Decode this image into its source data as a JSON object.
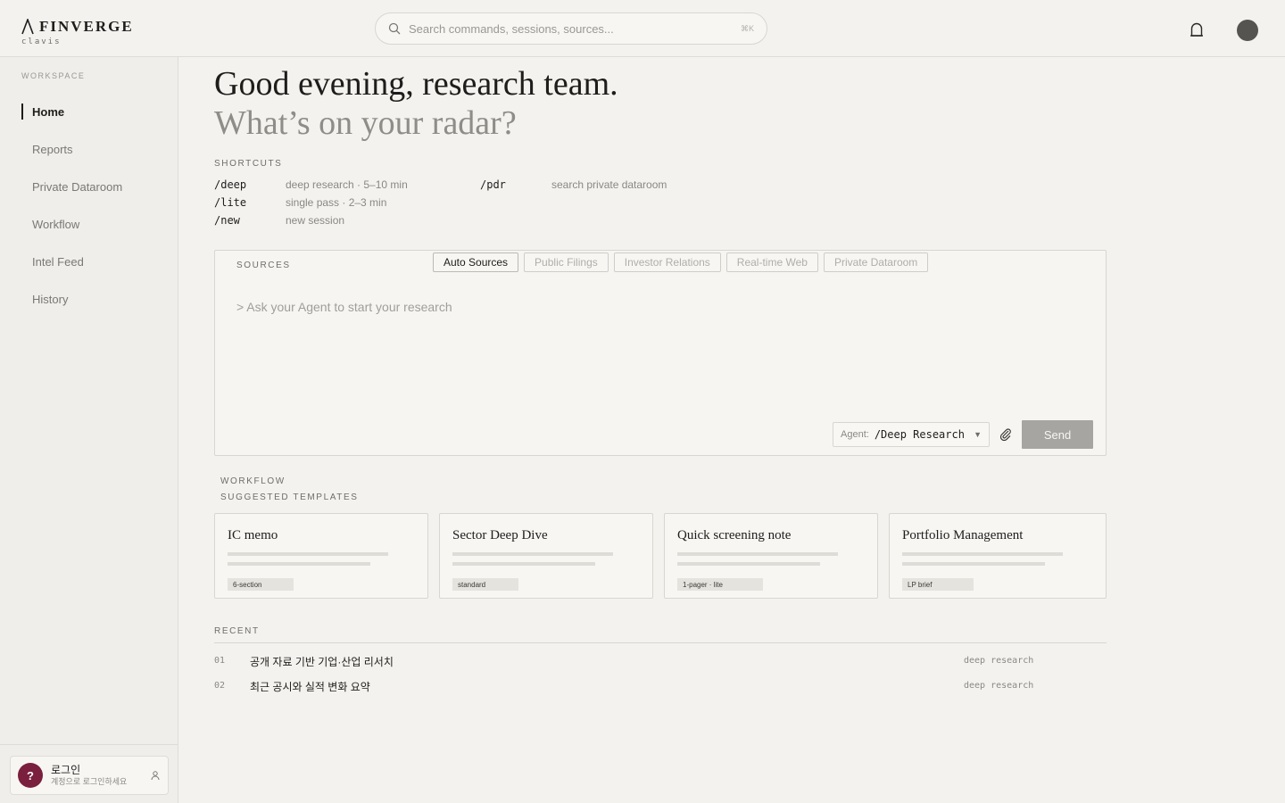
{
  "brand": {
    "name": "FINVERGE",
    "sub": "clavis"
  },
  "search": {
    "placeholder": "Search commands, sessions, sources...",
    "shortcut": "⌘K"
  },
  "sidebar": {
    "section_label": "WORKSPACE",
    "items": [
      {
        "label": "Home",
        "active": true
      },
      {
        "label": "Reports"
      },
      {
        "label": "Private Dataroom"
      },
      {
        "label": "Workflow"
      },
      {
        "label": "Intel Feed"
      },
      {
        "label": "History"
      }
    ],
    "login": {
      "avatar": "?",
      "title": "로그인",
      "subtitle": "계정으로 로그인하세요"
    }
  },
  "greeting": {
    "line1": "Good evening, research team.",
    "line2": "What’s on your radar?"
  },
  "shortcuts": {
    "label": "SHORTCUTS",
    "items": [
      {
        "cmd": "/deep",
        "desc": "deep research · 5–10 min"
      },
      {
        "cmd": "/lite",
        "desc": "single pass · 2–3 min"
      },
      {
        "cmd": "/new",
        "desc": "new session"
      },
      {
        "cmd": "/pdr",
        "desc": "search private dataroom"
      }
    ]
  },
  "composer": {
    "sources_label": "SOURCES",
    "chips": [
      {
        "label": "Auto Sources",
        "active": true
      },
      {
        "label": "Public Filings"
      },
      {
        "label": "Investor Relations"
      },
      {
        "label": "Real-time Web"
      },
      {
        "label": "Private Dataroom"
      }
    ],
    "placeholder": "> Ask your Agent to start your research",
    "agent_label": "Agent:",
    "agent_value": "/Deep Research",
    "send_label": "Send"
  },
  "workflow": {
    "label": "WORKFLOW",
    "templates_label": "SUGGESTED TEMPLATES",
    "templates": [
      {
        "title": "IC memo",
        "tag": "6-section"
      },
      {
        "title": "Sector Deep Dive",
        "tag": "standard"
      },
      {
        "title": "Quick screening note",
        "tag": "1-pager · lite"
      },
      {
        "title": "Portfolio Management",
        "tag": "LP brief"
      }
    ]
  },
  "recent": {
    "label": "RECENT",
    "items": [
      {
        "num": "01",
        "title": "공개 자료 기반 기업·산업 리서치",
        "type": "deep research"
      },
      {
        "num": "02",
        "title": "최근 공시와 실적 변화 요약",
        "type": "deep research"
      }
    ]
  },
  "colors": {
    "accent": "#1e1d1b",
    "login_avatar": "#7a1f3d",
    "send_disabled": "#a7a5a1"
  }
}
